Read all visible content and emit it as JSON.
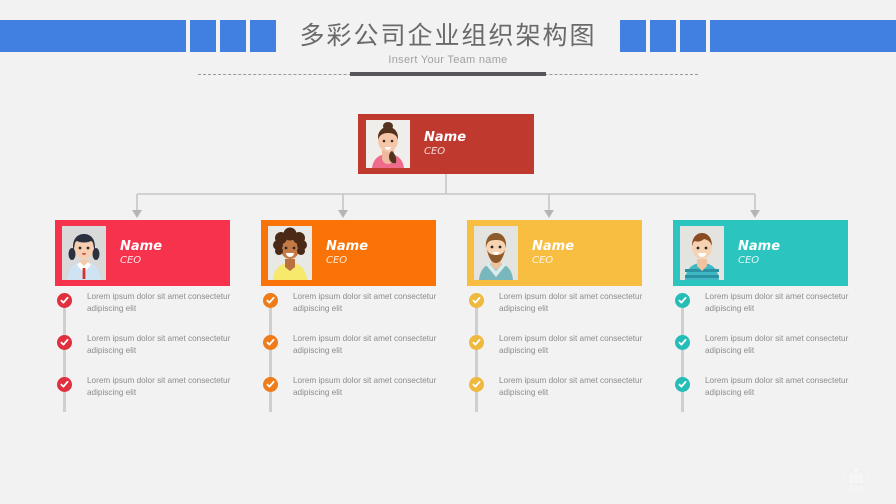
{
  "header": {
    "title": "多彩公司企业组织架构图",
    "subtitle": "Insert Your Team name",
    "deco_color": "#4180e0",
    "left_decoration": [
      "long-bar",
      "square",
      "square",
      "square"
    ],
    "right_decoration": [
      "square",
      "square",
      "square",
      "long-bar"
    ]
  },
  "root": {
    "name": "Name",
    "role": "CEO",
    "color": "#c0392f",
    "avatar": "female-bun-pink-top-avatar"
  },
  "children": [
    {
      "name": "Name",
      "role": "CEO",
      "color": "#f7324c",
      "bullet_color": "#e03040",
      "avatar": "girl-pigtails-red-tie-avatar",
      "bullets": [
        "Lorem ipsum dolor sit amet consectetur adipiscing elit",
        "Lorem ipsum dolor sit amet consectetur adipiscing elit",
        "Lorem ipsum dolor sit amet consectetur adipiscing elit"
      ]
    },
    {
      "name": "Name",
      "role": "CEO",
      "color": "#f97306",
      "bullet_color": "#ef7c1b",
      "avatar": "curly-hair-woman-yellow-top-avatar",
      "bullets": [
        "Lorem ipsum dolor sit amet consectetur adipiscing elit",
        "Lorem ipsum dolor sit amet consectetur adipiscing elit",
        "Lorem ipsum dolor sit amet consectetur adipiscing elit"
      ]
    },
    {
      "name": "Name",
      "role": "CEO",
      "color": "#f8be41",
      "bullet_color": "#efb83f",
      "avatar": "bearded-man-teal-shirt-avatar",
      "bullets": [
        "Lorem ipsum dolor sit amet consectetur adipiscing elit",
        "Lorem ipsum dolor sit amet consectetur adipiscing elit",
        "Lorem ipsum dolor sit amet consectetur adipiscing elit"
      ]
    },
    {
      "name": "Name",
      "role": "CEO",
      "color": "#2bc4bf",
      "bullet_color": "#27bdb7",
      "avatar": "young-man-teal-striped-shirt-avatar",
      "bullets": [
        "Lorem ipsum dolor sit amet consectetur adipiscing elit",
        "Lorem ipsum dolor sit amet consectetur adipiscing elit",
        "Lorem ipsum dolor sit amet consectetur adipiscing elit"
      ]
    }
  ],
  "connector": {
    "line_color": "#c6c6c6",
    "arrow_color": "#b5b5b5"
  }
}
